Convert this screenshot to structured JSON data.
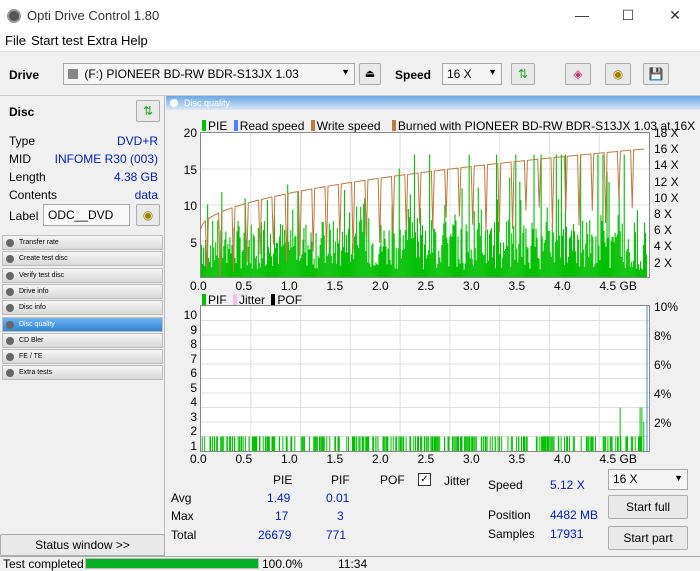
{
  "window": {
    "title": "Opti Drive Control 1.80"
  },
  "menu": {
    "file": "File",
    "start_test": "Start test",
    "extra": "Extra",
    "help": "Help"
  },
  "toolbar": {
    "drive_label": "Drive",
    "drive_value": "(F:)   PIONEER BD-RW  BDR-S13JX 1.03",
    "speed_label": "Speed",
    "speed_value": "16 X"
  },
  "disc": {
    "header": "Disc",
    "type_label": "Type",
    "type_value": "DVD+R",
    "mid_label": "MID",
    "mid_value": "INFOME R30 (003)",
    "length_label": "Length",
    "length_value": "4.38 GB",
    "contents_label": "Contents",
    "contents_value": "data",
    "label_label": "Label",
    "label_value": "ODC__DVD"
  },
  "nav": [
    "Transfer rate",
    "Create test disc",
    "Verify test disc",
    "Drive info",
    "Disc info",
    "Disc quality",
    "CD Bler",
    "FE / TE",
    "Extra tests"
  ],
  "nav_active": 5,
  "status_window": "Status window >>",
  "panel": {
    "title": "Disc quality"
  },
  "chart1": {
    "legend": {
      "pie": "PIE",
      "read": "Read speed",
      "write": "Write speed",
      "burned": "Burned with PIONEER BD-RW  BDR-S13JX 1.03 at 16X"
    },
    "y_left_ticks": [
      "20",
      "15",
      "10",
      "5"
    ],
    "y_right_ticks": [
      "18 X",
      "16 X",
      "14 X",
      "12 X",
      "10 X",
      "8 X",
      "6 X",
      "4 X",
      "2 X"
    ],
    "x_ticks": [
      "0.0",
      "0.5",
      "1.0",
      "1.5",
      "2.0",
      "2.5",
      "3.0",
      "3.5",
      "4.0",
      "4.5 GB"
    ]
  },
  "chart2": {
    "legend": {
      "pif": "PIF",
      "jitter": "Jitter",
      "pof": "POF"
    },
    "y_left_ticks": [
      "10",
      "9",
      "8",
      "7",
      "6",
      "5",
      "4",
      "3",
      "2",
      "1"
    ],
    "y_right_ticks": [
      "10%",
      "8%",
      "6%",
      "4%",
      "2%"
    ],
    "x_ticks": [
      "0.0",
      "0.5",
      "1.0",
      "1.5",
      "2.0",
      "2.5",
      "3.0",
      "3.5",
      "4.0",
      "4.5 GB"
    ]
  },
  "chart_data": [
    {
      "type": "bar",
      "series": [
        {
          "name": "PIE",
          "color": "#00c000"
        },
        {
          "name": "Write speed",
          "color": "#c0783c"
        }
      ],
      "x_range": [
        0,
        4.5
      ],
      "ylim": [
        0,
        20
      ],
      "y2lim": [
        0,
        18
      ],
      "xlabel": "GB"
    },
    {
      "type": "bar",
      "series": [
        {
          "name": "PIF",
          "color": "#00c000"
        }
      ],
      "x_range": [
        0,
        4.5
      ],
      "ylim": [
        0,
        10
      ],
      "y2lim": [
        0,
        10
      ],
      "xlabel": "GB"
    }
  ],
  "stats": {
    "col_pie": "PIE",
    "col_pif": "PIF",
    "col_pof": "POF",
    "jitter_label": "Jitter",
    "avg_label": "Avg",
    "avg_pie": "1.49",
    "avg_pif": "0.01",
    "max_label": "Max",
    "max_pie": "17",
    "max_pif": "3",
    "total_label": "Total",
    "total_pie": "26679",
    "total_pif": "771",
    "speed_label": "Speed",
    "speed_value": "5.12 X",
    "position_label": "Position",
    "position_value": "4482 MB",
    "samples_label": "Samples",
    "samples_value": "17931",
    "speed_select": "16 X",
    "start_full": "Start full",
    "start_part": "Start part"
  },
  "status": {
    "text": "Test completed",
    "progress": 1.0,
    "percent": "100.0%",
    "time": "11:34"
  },
  "colors": {
    "pie": "#00c000",
    "write": "#c0783c",
    "accent": "#3c8cdc"
  }
}
